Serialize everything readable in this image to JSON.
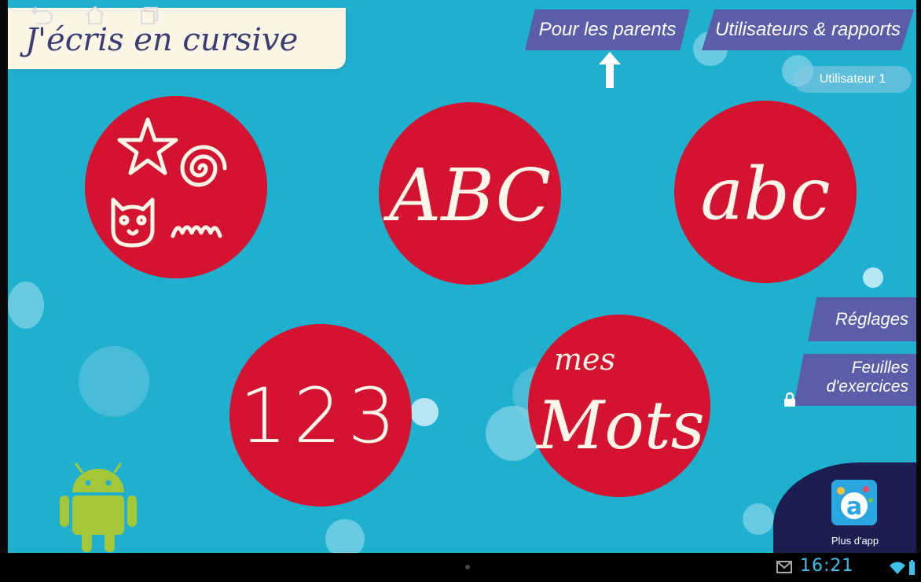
{
  "app": {
    "title": "J'écris en cursive"
  },
  "header": {
    "parents_label": "Pour les parents",
    "users_label": "Utilisateurs & rapports",
    "current_user": "Utilisateur 1"
  },
  "tiles": {
    "graphisme": {
      "icon": "shapes-star-spiral-cat-wave-icon"
    },
    "uppercase": {
      "label": "ABC"
    },
    "lowercase": {
      "label": "abc"
    },
    "numbers": {
      "label": "123"
    },
    "words": {
      "label_small": "mes",
      "label_large": "Mots"
    }
  },
  "side_menu": {
    "settings_label": "Réglages",
    "sheets_label_line1": "Feuilles",
    "sheets_label_line2": "d'exercices",
    "sheets_locked": true
  },
  "more_apps": {
    "label": "Plus d'app"
  },
  "status_bar": {
    "time": "16:21",
    "icons": [
      "back-icon",
      "home-icon",
      "recent-apps-icon",
      "mail-icon",
      "wifi-icon",
      "battery-icon"
    ]
  },
  "colors": {
    "background": "#1fb0d0",
    "tile_red": "#d3132f",
    "ribbon_purple": "#5a5ea8",
    "title_card": "#fbf5e6",
    "navy": "#1c1e52"
  }
}
